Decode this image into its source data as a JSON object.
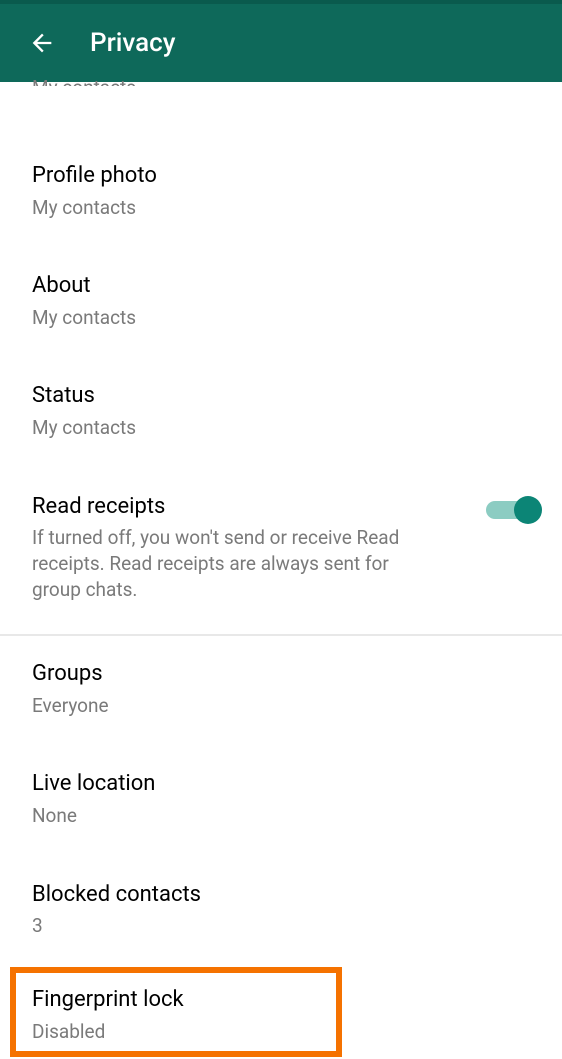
{
  "header": {
    "title": "Privacy"
  },
  "settings": {
    "partial_top": {
      "subtitle": "My contacts"
    },
    "profile_photo": {
      "title": "Profile photo",
      "subtitle": "My contacts"
    },
    "about": {
      "title": "About",
      "subtitle": "My contacts"
    },
    "status": {
      "title": "Status",
      "subtitle": "My contacts"
    },
    "read_receipts": {
      "title": "Read receipts",
      "description": "If turned off, you won't send or receive Read receipts. Read receipts are always sent for group chats.",
      "enabled": true
    },
    "groups": {
      "title": "Groups",
      "subtitle": "Everyone"
    },
    "live_location": {
      "title": "Live location",
      "subtitle": "None"
    },
    "blocked_contacts": {
      "title": "Blocked contacts",
      "subtitle": "3"
    },
    "fingerprint_lock": {
      "title": "Fingerprint lock",
      "subtitle": "Disabled"
    }
  },
  "colors": {
    "header_bg": "#0e695a",
    "toggle_on": "#0c8576",
    "highlight": "#f57200"
  }
}
